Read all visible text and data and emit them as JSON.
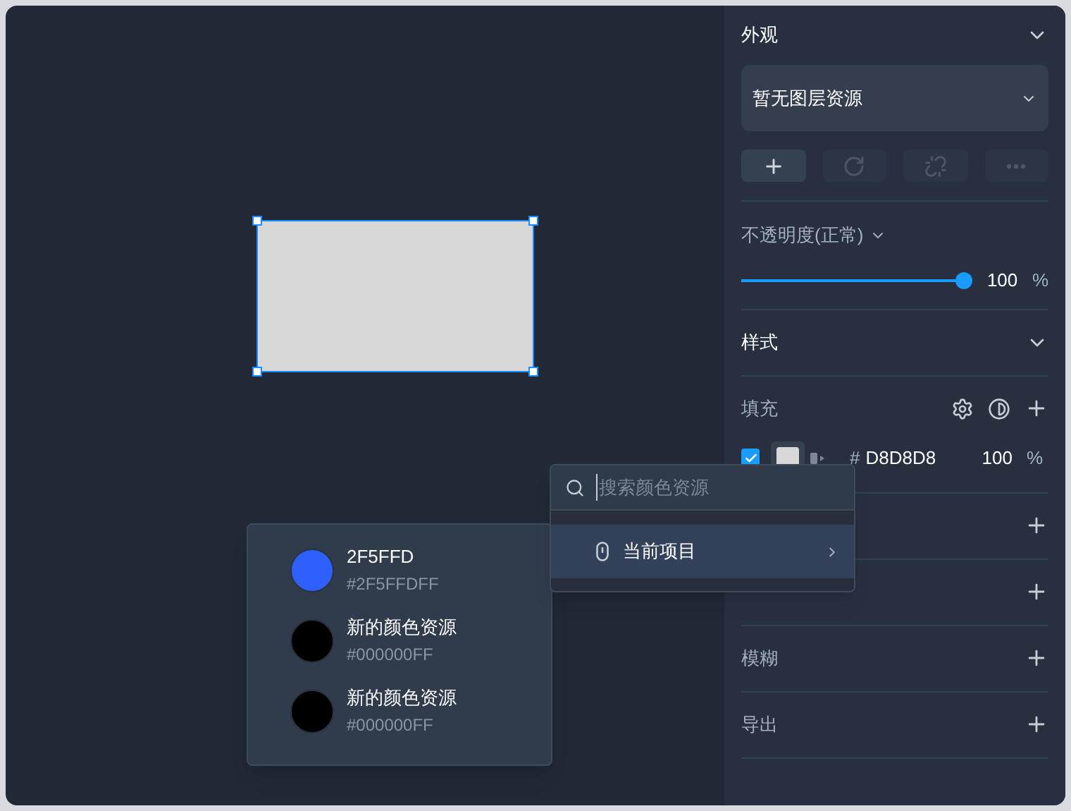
{
  "canvas": {
    "shape": {
      "selected": true
    }
  },
  "panel": {
    "appearance": {
      "title": "外观",
      "expanded": true,
      "layer_select": {
        "value": "暂无图层资源"
      },
      "actions": [
        {
          "kind": "add",
          "disabled": false
        },
        {
          "kind": "refresh",
          "disabled": true
        },
        {
          "kind": "unlink",
          "disabled": true
        },
        {
          "kind": "more",
          "disabled": true
        }
      ],
      "opacity": {
        "label": "不透明度(正常)",
        "level": 1,
        "reading": "100",
        "unit": "%"
      }
    },
    "style": {
      "title": "样式",
      "expanded": true
    },
    "fill": {
      "title": "填充",
      "enabled": true,
      "hex_prefix": "#",
      "hex": "D8D8D8",
      "opacity": "100",
      "unit": "%"
    },
    "sections": [
      {
        "kind": "covered"
      },
      {
        "kind": "covered"
      },
      {
        "kind": "labeled",
        "title": "模糊"
      },
      {
        "kind": "labeled",
        "title": "导出"
      }
    ]
  },
  "color_search": {
    "placeholder": "搜索颜色资源",
    "items": [
      {
        "label": "当前项目",
        "selected": true
      }
    ]
  },
  "color_list": [
    {
      "name": "2F5FFD",
      "value": "#2F5FFDFF",
      "color": "#2f5ffd"
    },
    {
      "name": "新的颜色资源",
      "value": "#000000FF",
      "color": "#000000"
    },
    {
      "name": "新的颜色资源",
      "value": "#000000FF",
      "color": "#000000"
    }
  ]
}
